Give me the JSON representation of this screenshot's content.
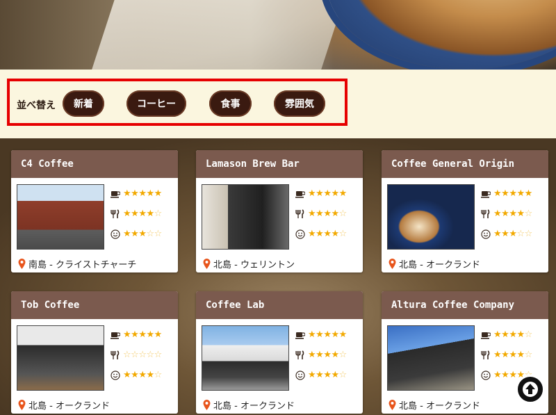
{
  "sort": {
    "label": "並べ替え",
    "options": [
      "新着",
      "コーヒー",
      "食事",
      "雰囲気"
    ]
  },
  "colors": {
    "header_bar": "#7b5a4e",
    "pill_bg": "#3a1a10",
    "highlight_border": "#e60000",
    "star": "#f2a900"
  },
  "rating_icons": [
    "coffee-cup-icon",
    "fork-knife-icon",
    "smiley-icon"
  ],
  "cafes": [
    {
      "name": "C4 Coffee",
      "location": "南島 - クライストチャーチ",
      "ratings": [
        5,
        4,
        3
      ]
    },
    {
      "name": "Lamason Brew Bar",
      "location": "北島 - ウェリントン",
      "ratings": [
        5,
        4,
        4
      ]
    },
    {
      "name": "Coffee General Origin",
      "location": "北島 - オークランド",
      "ratings": [
        5,
        4,
        3
      ]
    },
    {
      "name": "Tob Coffee",
      "location": "北島 - オークランド",
      "ratings": [
        5,
        0,
        4
      ]
    },
    {
      "name": "Coffee Lab",
      "location": "北島 - オークランド",
      "ratings": [
        5,
        4,
        4
      ]
    },
    {
      "name": "Altura Coffee Company",
      "location": "北島 - オークランド",
      "ratings": [
        4,
        4,
        4
      ]
    }
  ]
}
